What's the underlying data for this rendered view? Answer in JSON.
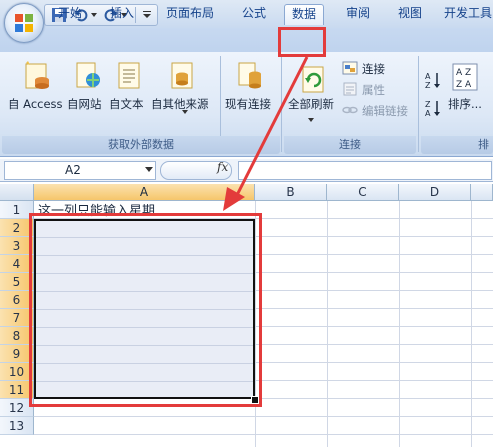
{
  "ribbon": {
    "tabs": [
      {
        "label": "开始"
      },
      {
        "label": "插入"
      },
      {
        "label": "页面布局"
      },
      {
        "label": "公式"
      },
      {
        "label": "数据"
      },
      {
        "label": "审阅"
      },
      {
        "label": "视图"
      },
      {
        "label": "开发工具"
      }
    ],
    "active_tab": "数据",
    "groups": {
      "external_data": {
        "label": "获取外部数据",
        "buttons": [
          {
            "label": "自 Access"
          },
          {
            "label": "自网站"
          },
          {
            "label": "自文本"
          },
          {
            "label": "自其他来源"
          },
          {
            "label": "现有连接"
          }
        ]
      },
      "connections": {
        "label": "连接",
        "refresh_all": "全部刷新",
        "items": [
          {
            "label": "连接"
          },
          {
            "label": "属性"
          },
          {
            "label": "编辑链接"
          }
        ]
      },
      "sort_filter": {
        "label": "排",
        "sort_label": "排序..."
      }
    }
  },
  "formula_bar": {
    "name_box": "A2",
    "fx": "fx",
    "formula": ""
  },
  "sheet": {
    "columns": [
      "A",
      "B",
      "C",
      "D"
    ],
    "rows": [
      "1",
      "2",
      "3",
      "4",
      "5",
      "6",
      "7",
      "8",
      "9",
      "10",
      "11",
      "12",
      "13"
    ],
    "cells": {
      "A1": "这一列只能输入星期"
    },
    "selected_range": "A2:A11"
  },
  "colors": {
    "annotation_red": "#e33b3b",
    "ribbon_bg": "#dde8f6",
    "selection_fill": "#e9edf6"
  }
}
